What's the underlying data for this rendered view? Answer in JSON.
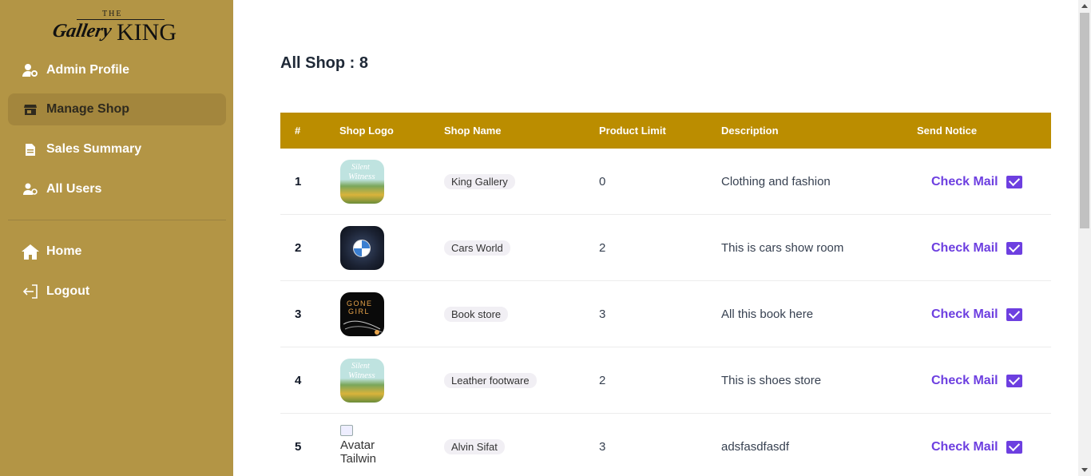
{
  "brand": {
    "the": "THE",
    "gallery": "Gallery",
    "king": "KING"
  },
  "sidebar": {
    "items": [
      {
        "label": "Admin Profile",
        "icon": "user-gear-icon"
      },
      {
        "label": "Manage Shop",
        "icon": "shop-icon",
        "active": true
      },
      {
        "label": "Sales Summary",
        "icon": "document-icon"
      },
      {
        "label": "All Users",
        "icon": "users-icon"
      }
    ],
    "bottom_items": [
      {
        "label": "Home",
        "icon": "home-icon"
      },
      {
        "label": "Logout",
        "icon": "logout-icon"
      }
    ]
  },
  "main": {
    "title": "All Shop : 8",
    "columns": [
      "#",
      "Shop Logo",
      "Shop Name",
      "Product Limit",
      "Description",
      "Send Notice"
    ],
    "rows": [
      {
        "num": "1",
        "logo": "silent-witness-cover",
        "name": "King Gallery",
        "limit": "0",
        "description": "Clothing and fashion",
        "action": "Check Mail"
      },
      {
        "num": "2",
        "logo": "bmw-logo",
        "name": "Cars World",
        "limit": "2",
        "description": "This is cars show room",
        "action": "Check Mail"
      },
      {
        "num": "3",
        "logo": "gone-girl-cover",
        "name": "Book store",
        "limit": "3",
        "description": "All this book here",
        "action": "Check Mail"
      },
      {
        "num": "4",
        "logo": "silent-witness-cover",
        "name": "Leather footware",
        "limit": "2",
        "description": "This is shoes store",
        "action": "Check Mail"
      },
      {
        "num": "5",
        "logo": "broken-image",
        "logo_alt": "Avatar Tailwin",
        "name": "Alvin Sifat",
        "limit": "3",
        "description": "adsfasdfasdf",
        "action": "Check Mail"
      }
    ]
  },
  "colors": {
    "sidebar_bg": "#b39545",
    "header_bg": "#bb8d00",
    "accent": "#6d3fe0"
  }
}
